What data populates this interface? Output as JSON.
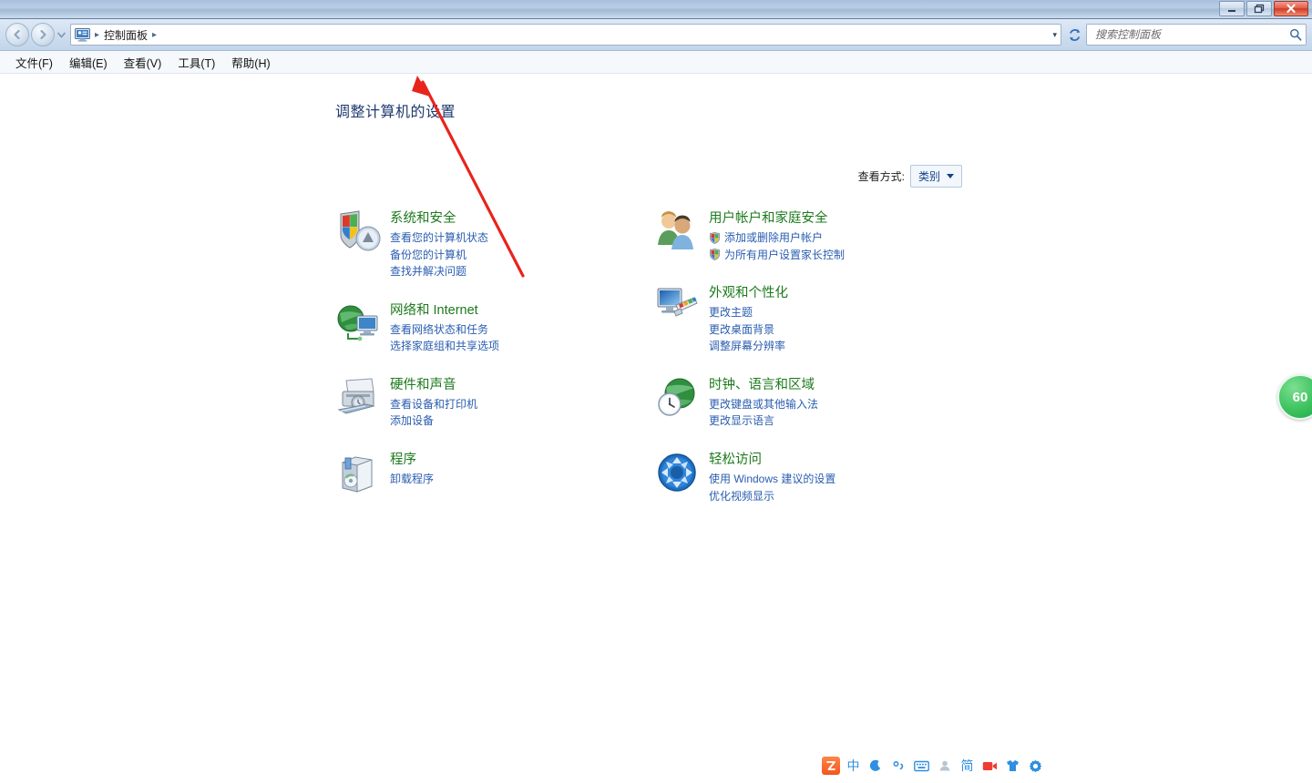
{
  "window": {
    "buttons": {
      "minimize": "minimize",
      "restore": "restore",
      "close": "close"
    }
  },
  "addressbar": {
    "back": "back",
    "forward": "forward",
    "history_dropdown": "recent-locations",
    "breadcrumb_icon": "control-panel-icon",
    "breadcrumb": "控制面板",
    "separator": "▸",
    "address_dropdown": "▾",
    "refresh": "refresh",
    "search_placeholder": "搜索控制面板",
    "search_value": ""
  },
  "menubar": {
    "items": [
      {
        "label": "文件(F)",
        "name": "menu-file"
      },
      {
        "label": "编辑(E)",
        "name": "menu-edit"
      },
      {
        "label": "查看(V)",
        "name": "menu-view"
      },
      {
        "label": "工具(T)",
        "name": "menu-tools"
      },
      {
        "label": "帮助(H)",
        "name": "menu-help"
      }
    ]
  },
  "main": {
    "page_title": "调整计算机的设置",
    "viewby_label": "查看方式:",
    "viewby_value": "类别",
    "left_categories": [
      {
        "title": "系统和安全",
        "icon": "security-shield-icon",
        "links": [
          {
            "text": "查看您的计算机状态",
            "shield": false
          },
          {
            "text": "备份您的计算机",
            "shield": false
          },
          {
            "text": "查找并解决问题",
            "shield": false
          }
        ]
      },
      {
        "title": "网络和 Internet",
        "icon": "network-globe-icon",
        "links": [
          {
            "text": "查看网络状态和任务",
            "shield": false
          },
          {
            "text": "选择家庭组和共享选项",
            "shield": false
          }
        ]
      },
      {
        "title": "硬件和声音",
        "icon": "printer-device-icon",
        "links": [
          {
            "text": "查看设备和打印机",
            "shield": false
          },
          {
            "text": "添加设备",
            "shield": false
          }
        ]
      },
      {
        "title": "程序",
        "icon": "programs-box-icon",
        "links": [
          {
            "text": "卸载程序",
            "shield": false
          }
        ]
      }
    ],
    "right_categories": [
      {
        "title": "用户帐户和家庭安全",
        "icon": "user-accounts-icon",
        "links": [
          {
            "text": "添加或删除用户帐户",
            "shield": true
          },
          {
            "text": "为所有用户设置家长控制",
            "shield": true
          }
        ]
      },
      {
        "title": "外观和个性化",
        "icon": "appearance-palette-icon",
        "links": [
          {
            "text": "更改主题",
            "shield": false
          },
          {
            "text": "更改桌面背景",
            "shield": false
          },
          {
            "text": "调整屏幕分辨率",
            "shield": false
          }
        ]
      },
      {
        "title": "时钟、语言和区域",
        "icon": "clock-globe-icon",
        "links": [
          {
            "text": "更改键盘或其他输入法",
            "shield": false
          },
          {
            "text": "更改显示语言",
            "shield": false
          }
        ]
      },
      {
        "title": "轻松访问",
        "icon": "ease-of-access-icon",
        "links": [
          {
            "text": "使用 Windows 建议的设置",
            "shield": false
          },
          {
            "text": "优化视频显示",
            "shield": false
          }
        ]
      }
    ]
  },
  "overlay": {
    "badge_value": "60",
    "arrow": "red-pointer-arrow"
  },
  "ime_toolbar": {
    "items": [
      {
        "name": "sogou-logo-icon",
        "glyph": "S"
      },
      {
        "name": "chinese-mode-icon",
        "glyph": "中"
      },
      {
        "name": "moon-icon",
        "glyph": "☽"
      },
      {
        "name": "punctuation-icon",
        "glyph": "°,"
      },
      {
        "name": "soft-keyboard-icon",
        "glyph": "⌨"
      },
      {
        "name": "user-icon",
        "glyph": "●"
      },
      {
        "name": "simplified-chinese-icon",
        "glyph": "简"
      },
      {
        "name": "video-icon",
        "glyph": "▶"
      },
      {
        "name": "skin-icon",
        "glyph": "ὅ5"
      },
      {
        "name": "settings-gear-icon",
        "glyph": "⚙"
      }
    ]
  },
  "colors": {
    "accent_blue": "#2a5db0",
    "category_green": "#1d7a1d",
    "title_blue": "#1f3a6e",
    "arrow_red": "#e8241b",
    "badge_green": "#3cc35e"
  }
}
